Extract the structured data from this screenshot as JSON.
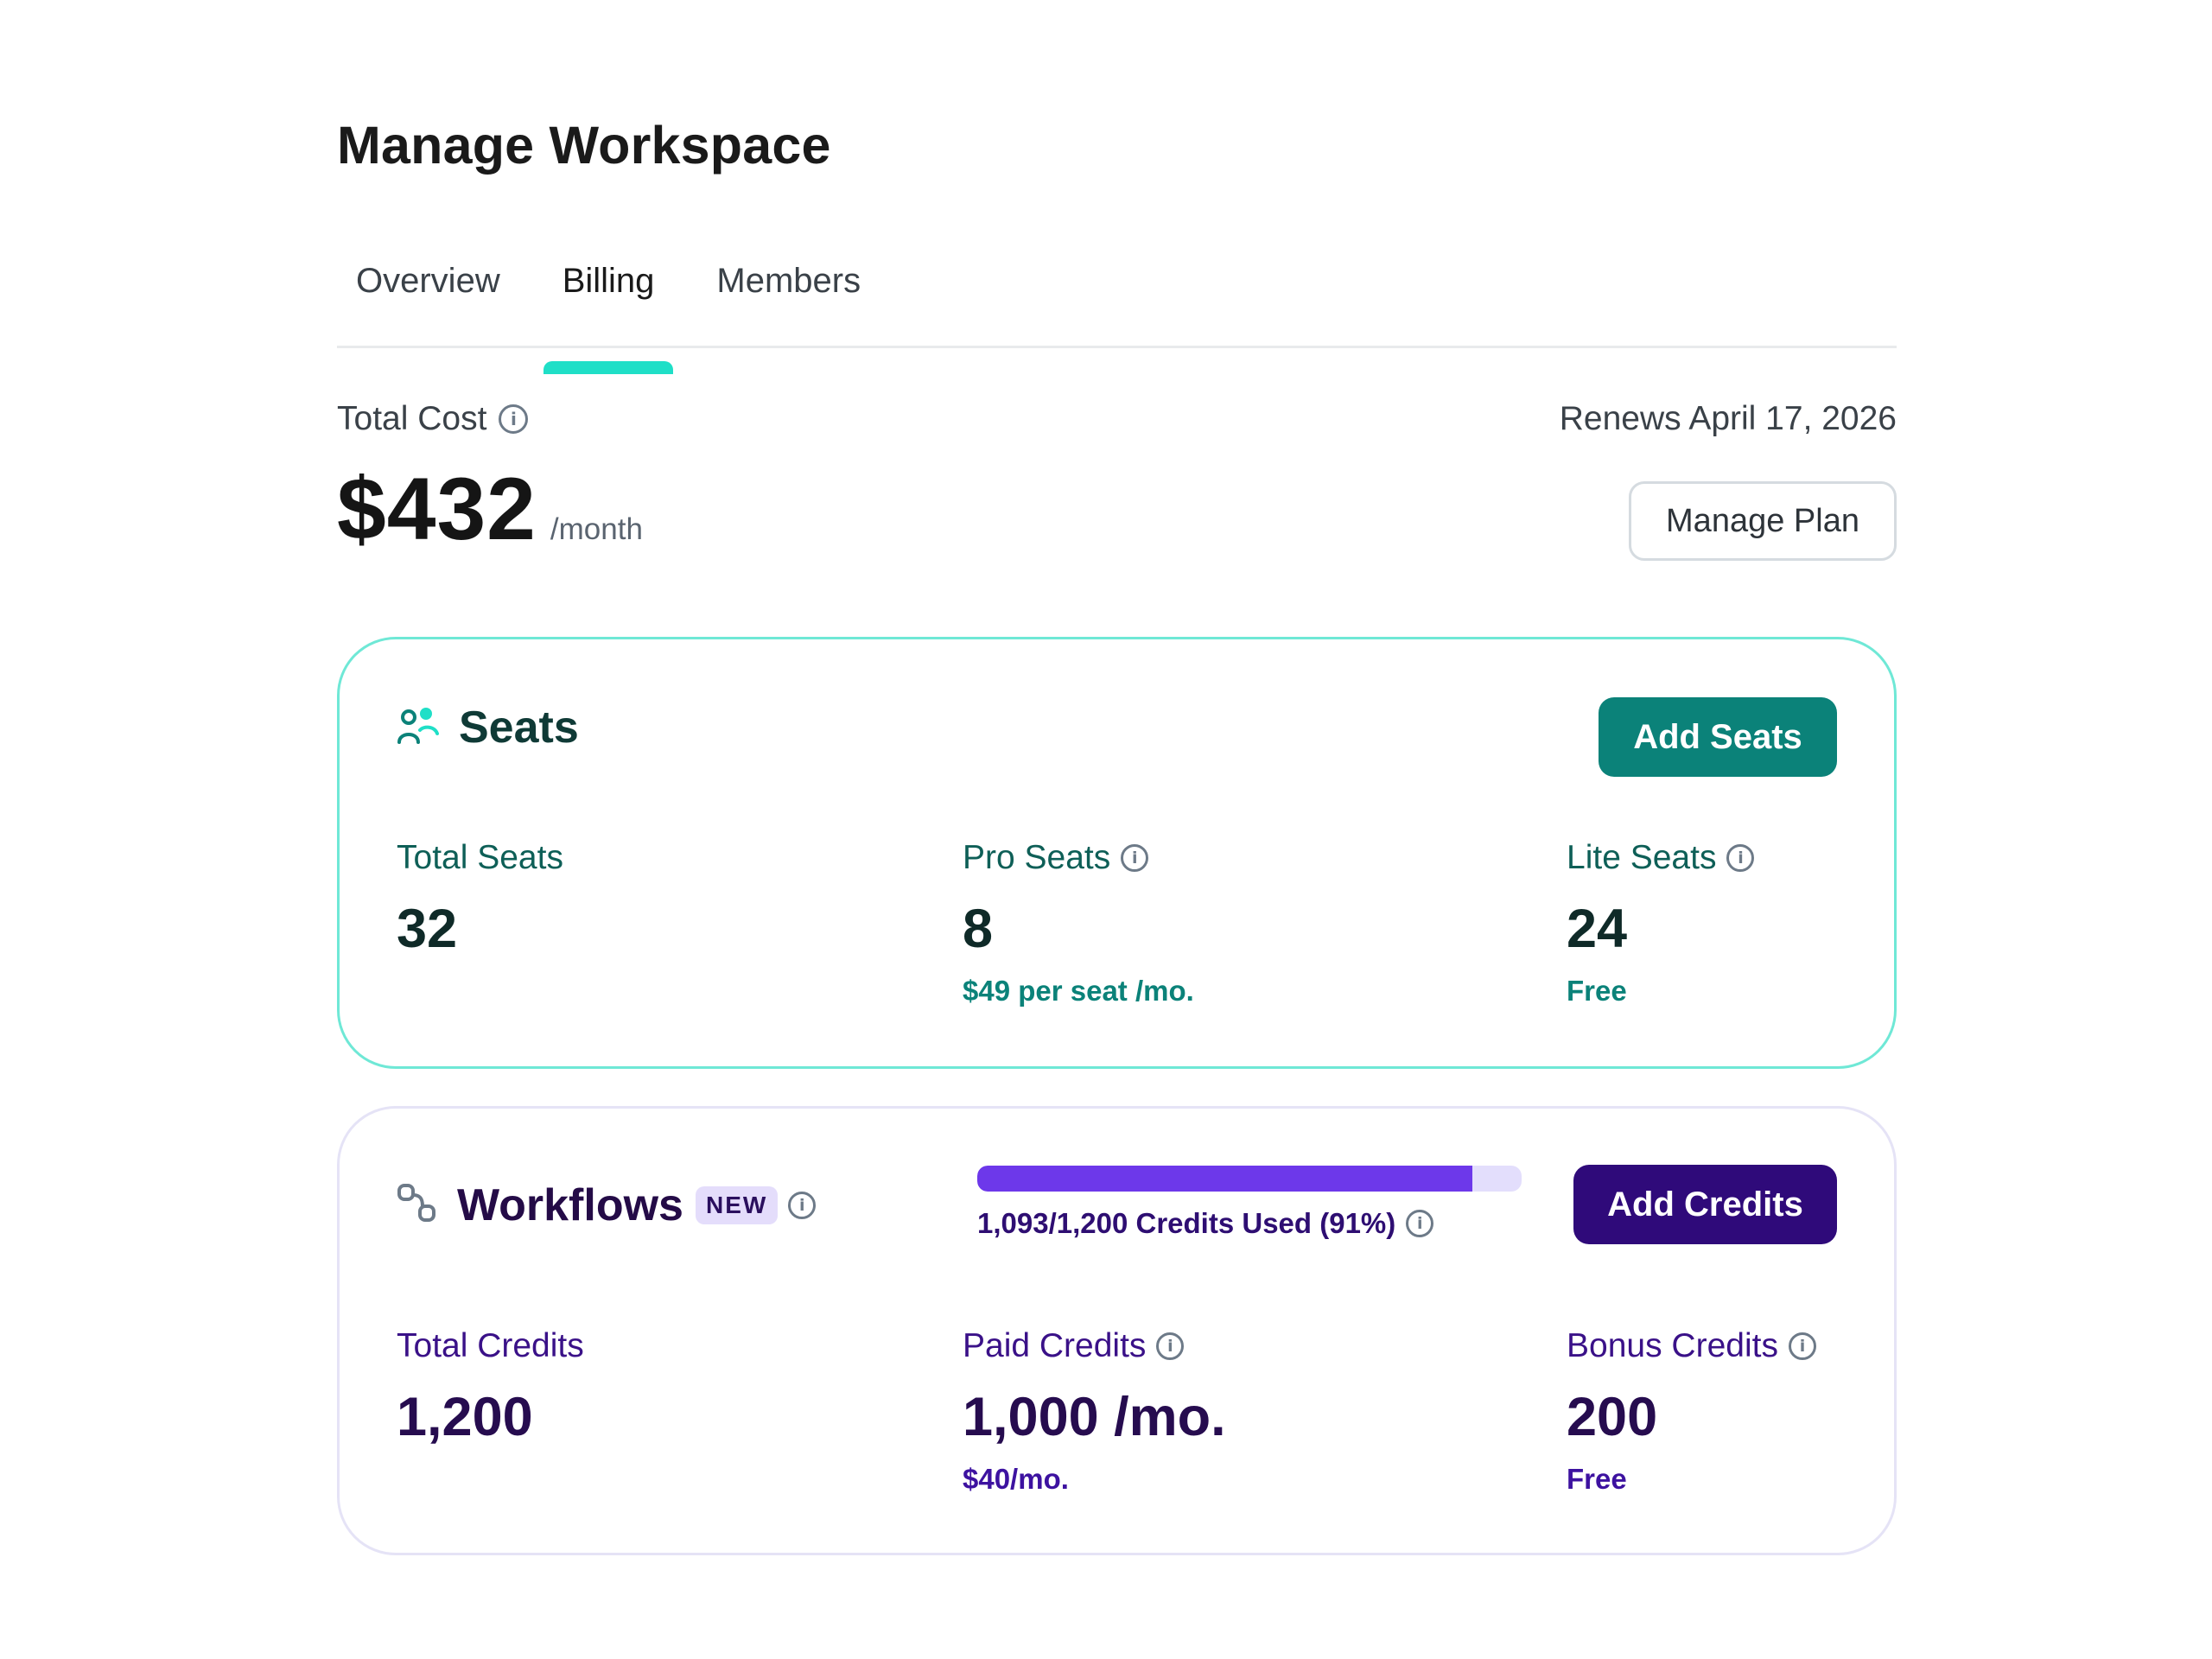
{
  "page": {
    "title": "Manage Workspace"
  },
  "tabs": [
    {
      "label": "Overview",
      "active": false
    },
    {
      "label": "Billing",
      "active": true
    },
    {
      "label": "Members",
      "active": false
    }
  ],
  "billing": {
    "total_cost_label": "Total Cost",
    "total_cost_amount": "$432",
    "total_cost_unit": "/month",
    "renewal_text": "Renews April 17, 2026",
    "manage_plan_label": "Manage Plan"
  },
  "seats": {
    "title": "Seats",
    "add_button_label": "Add Seats",
    "icon": "users-icon",
    "accent_color": "#0b8279",
    "stats": [
      {
        "label": "Total Seats",
        "value": "32",
        "sub": ""
      },
      {
        "label": "Pro Seats",
        "value": "8",
        "sub": "$49 per seat /mo."
      },
      {
        "label": "Lite Seats",
        "value": "24",
        "sub": "Free"
      }
    ]
  },
  "workflows": {
    "title": "Workflows",
    "badge": "NEW",
    "add_button_label": "Add Credits",
    "icon": "workflow-icon",
    "accent_color": "#2f0a7a",
    "usage": {
      "label": "1,093/1,200 Credits Used (91%)",
      "fraction": 0.91
    },
    "stats": [
      {
        "label": "Total Credits",
        "value": "1,200",
        "sub": ""
      },
      {
        "label": "Paid Credits",
        "value": "1,000 /mo.",
        "sub": "$40/mo."
      },
      {
        "label": "Bonus Credits",
        "value": "200",
        "sub": "Free"
      }
    ]
  }
}
